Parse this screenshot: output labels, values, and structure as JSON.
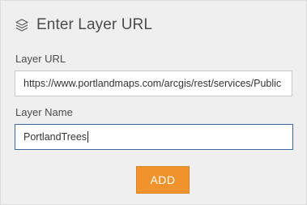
{
  "header": {
    "icon": "layers-icon",
    "title": "Enter Layer URL"
  },
  "layer_url": {
    "label": "Layer URL",
    "value": "https://www.portlandmaps.com/arcgis/rest/services/Public"
  },
  "layer_name": {
    "label": "Layer Name",
    "value": "PortlandTrees"
  },
  "actions": {
    "add_label": "ADD",
    "add_color": "#f0932d"
  }
}
